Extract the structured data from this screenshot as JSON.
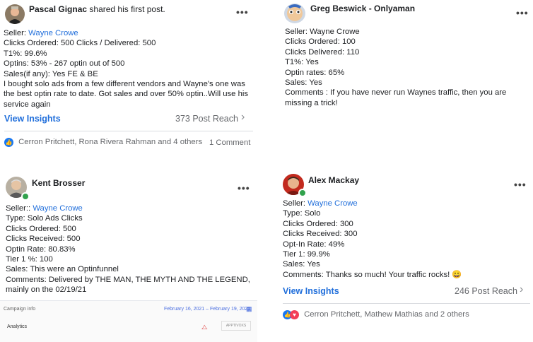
{
  "posts": [
    {
      "author": "Pascal Gignac",
      "action": "shared his first post.",
      "more": "•••",
      "lines": [
        {
          "label": "Seller: ",
          "link": "Wayne Crowe"
        },
        {
          "text": "Clicks Ordered: 500 Clicks / Delivered: 500"
        },
        {
          "text": "T1%: 99.6%"
        },
        {
          "text": "Optins: 53% - 267 optin out of 500"
        },
        {
          "text": "Sales(if any): Yes FE & BE"
        },
        {
          "text": "I bought solo ads from a few different vendors and Wayne's one was the best optin rate to date.  Got sales and over 50% optin..Will use his service again"
        }
      ],
      "insights": "View Insights",
      "reach": "373 Post Reach",
      "reactions": "Cerron Pritchett, Rona Rivera Rahman and 4 others",
      "comments": "1 Comment"
    },
    {
      "author": "Greg Beswick - Onlyaman",
      "more": "•••",
      "lines": [
        {
          "text": "Seller: Wayne Crowe"
        },
        {
          "text": "Clicks Ordered: 100"
        },
        {
          "text": "Clicks Delivered: 110"
        },
        {
          "text": "T1%: Yes"
        },
        {
          "text": "Optin rates: 65%"
        },
        {
          "text": "Sales: Yes"
        },
        {
          "text": "Comments : If you have never run Waynes traffic, then you are missing a trick!"
        }
      ]
    },
    {
      "author": "Kent Brosser",
      "more": "•••",
      "lines": [
        {
          "label": "Seller:: ",
          "link": "Wayne Crowe"
        },
        {
          "text": "Type: Solo Ads Clicks"
        },
        {
          "text": "Clicks Ordered: 500"
        },
        {
          "text": "Clicks Received: 500"
        },
        {
          "text": "Optin Rate: 80.83%"
        },
        {
          "text": "Tier 1 %: 100"
        },
        {
          "text": "Sales: This were an Optinfunnel"
        },
        {
          "text": "Comments: Delivered by THE MAN, THE MYTH AND THE LEGEND, mainly on the 02/19/21"
        }
      ]
    },
    {
      "author": "Alex Mackay",
      "more": "•••",
      "lines": [
        {
          "label": "Seller: ",
          "link": "Wayne Crowe"
        },
        {
          "text": "Type: Solo"
        },
        {
          "text": "Clicks Ordered: 300"
        },
        {
          "text": "Clicks Received: 300"
        },
        {
          "text": "Opt-In Rate: 49%"
        },
        {
          "text": "Tier 1: 99.9%"
        },
        {
          "text": "Sales: Yes"
        },
        {
          "text": "Comments: Thanks so much! Your traffic rocks! 😀"
        }
      ],
      "insights": "View Insights",
      "reach": "246 Post Reach",
      "reactions": "Cerron Pritchett, Mathew Mathias and 2 others"
    }
  ],
  "campaign": {
    "title": "Campaign info",
    "dates": "February 16, 2021 – February 19, 2021",
    "analytics": "Analytics",
    "box": "APPTIVOXS"
  },
  "icons": {
    "chevron": "›",
    "like": "👍",
    "love": "♥",
    "calendar": "▦",
    "logo": "⧍"
  },
  "colors": {
    "link": "#216fdb",
    "online": "#31a24c",
    "like": "#1877f2",
    "love": "#f33e58"
  }
}
